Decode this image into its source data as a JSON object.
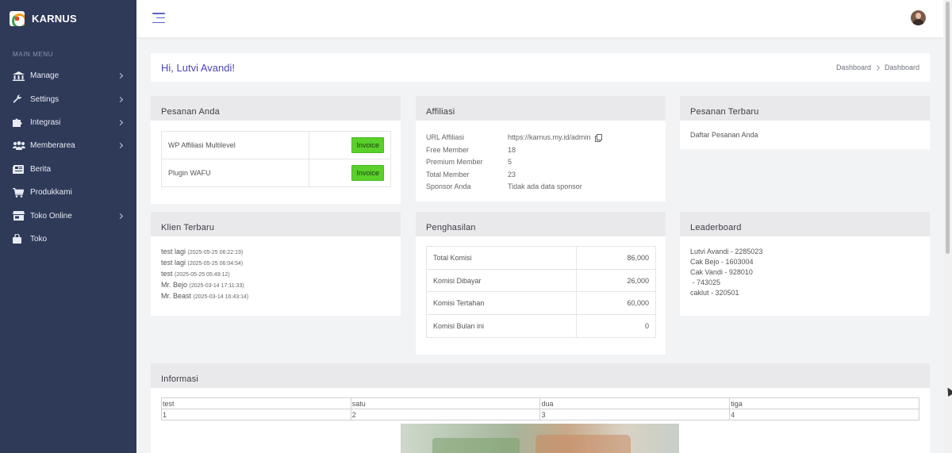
{
  "brand": {
    "name": "KARNUS"
  },
  "sidebar": {
    "heading": "MAIN MENU",
    "items": [
      {
        "label": "Manage",
        "icon": "bank-icon",
        "has_children": true
      },
      {
        "label": "Settings",
        "icon": "wrench-icon",
        "has_children": true
      },
      {
        "label": "Integrasi",
        "icon": "puzzle-icon",
        "has_children": true
      },
      {
        "label": "Memberarea",
        "icon": "users-icon",
        "has_children": true
      },
      {
        "label": "Berita",
        "icon": "newspaper-icon",
        "has_children": false
      },
      {
        "label": "Produkkami",
        "icon": "cart-icon",
        "has_children": false
      },
      {
        "label": "Toko Online",
        "icon": "store-icon",
        "has_children": true
      },
      {
        "label": "Toko",
        "icon": "shopping-bag-icon",
        "has_children": false
      }
    ]
  },
  "greeting": {
    "title": "Hi, Lutvi Avandi!"
  },
  "breadcrumb": {
    "items": [
      "Dashboard",
      "Dashboard"
    ]
  },
  "pesanan_anda": {
    "title": "Pesanan Anda",
    "rows": [
      {
        "name": "WP Affiliasi Multilevel",
        "action": "Invoice"
      },
      {
        "name": "Plugin WAFU",
        "action": "Invoice"
      }
    ]
  },
  "affiliasi": {
    "title": "Affiliasi",
    "rows": [
      {
        "key": "URL Affiliasi",
        "value": "https://karnus.my.id/admin"
      },
      {
        "key": "Free Member",
        "value": "18"
      },
      {
        "key": "Premium Member",
        "value": "5"
      },
      {
        "key": "Total Member",
        "value": "23"
      },
      {
        "key": "Sponsor Anda",
        "value": "Tidak ada data sponsor"
      }
    ]
  },
  "pesanan_terbaru": {
    "title": "Pesanan Terbaru",
    "text": "Daftar Pesanan Anda"
  },
  "klien_terbaru": {
    "title": "Klien Terbaru",
    "rows": [
      {
        "name": "test lagi",
        "ts": "(2025-05-25 06:22:19)"
      },
      {
        "name": "test lagi",
        "ts": "(2025-05-25 06:04:54)"
      },
      {
        "name": "test",
        "ts": "(2025-05-25 05:49:12)"
      },
      {
        "name": "Mr. Bejo",
        "ts": "(2025-03-14 17:11:33)"
      },
      {
        "name": "Mr. Beast",
        "ts": "(2025-03-14 16:43:14)"
      }
    ]
  },
  "penghasilan": {
    "title": "Penghasilan",
    "rows": [
      {
        "label": "Total Komisi",
        "value": "86,000"
      },
      {
        "label": "Komisi Dibayar",
        "value": "26,000"
      },
      {
        "label": "Komisi Tertahan",
        "value": "60,000"
      },
      {
        "label": "Komisi Bulan ini",
        "value": "0"
      }
    ]
  },
  "leaderboard": {
    "title": "Leaderboard",
    "rows": [
      "Lutvi Avandi - 2285023",
      "Cak Bejo - 1603004",
      "Cak Vandi - 928010",
      " - 743025",
      "caklut - 320501"
    ]
  },
  "informasi": {
    "title": "Informasi",
    "table": [
      [
        "test",
        "satu",
        "dua",
        "tiga"
      ],
      [
        "1",
        "2",
        "3",
        "4"
      ]
    ]
  },
  "colors": {
    "sidebar": "#2f3a59",
    "accent": "#4c46b8",
    "invoice_button": "#5ad12b"
  }
}
